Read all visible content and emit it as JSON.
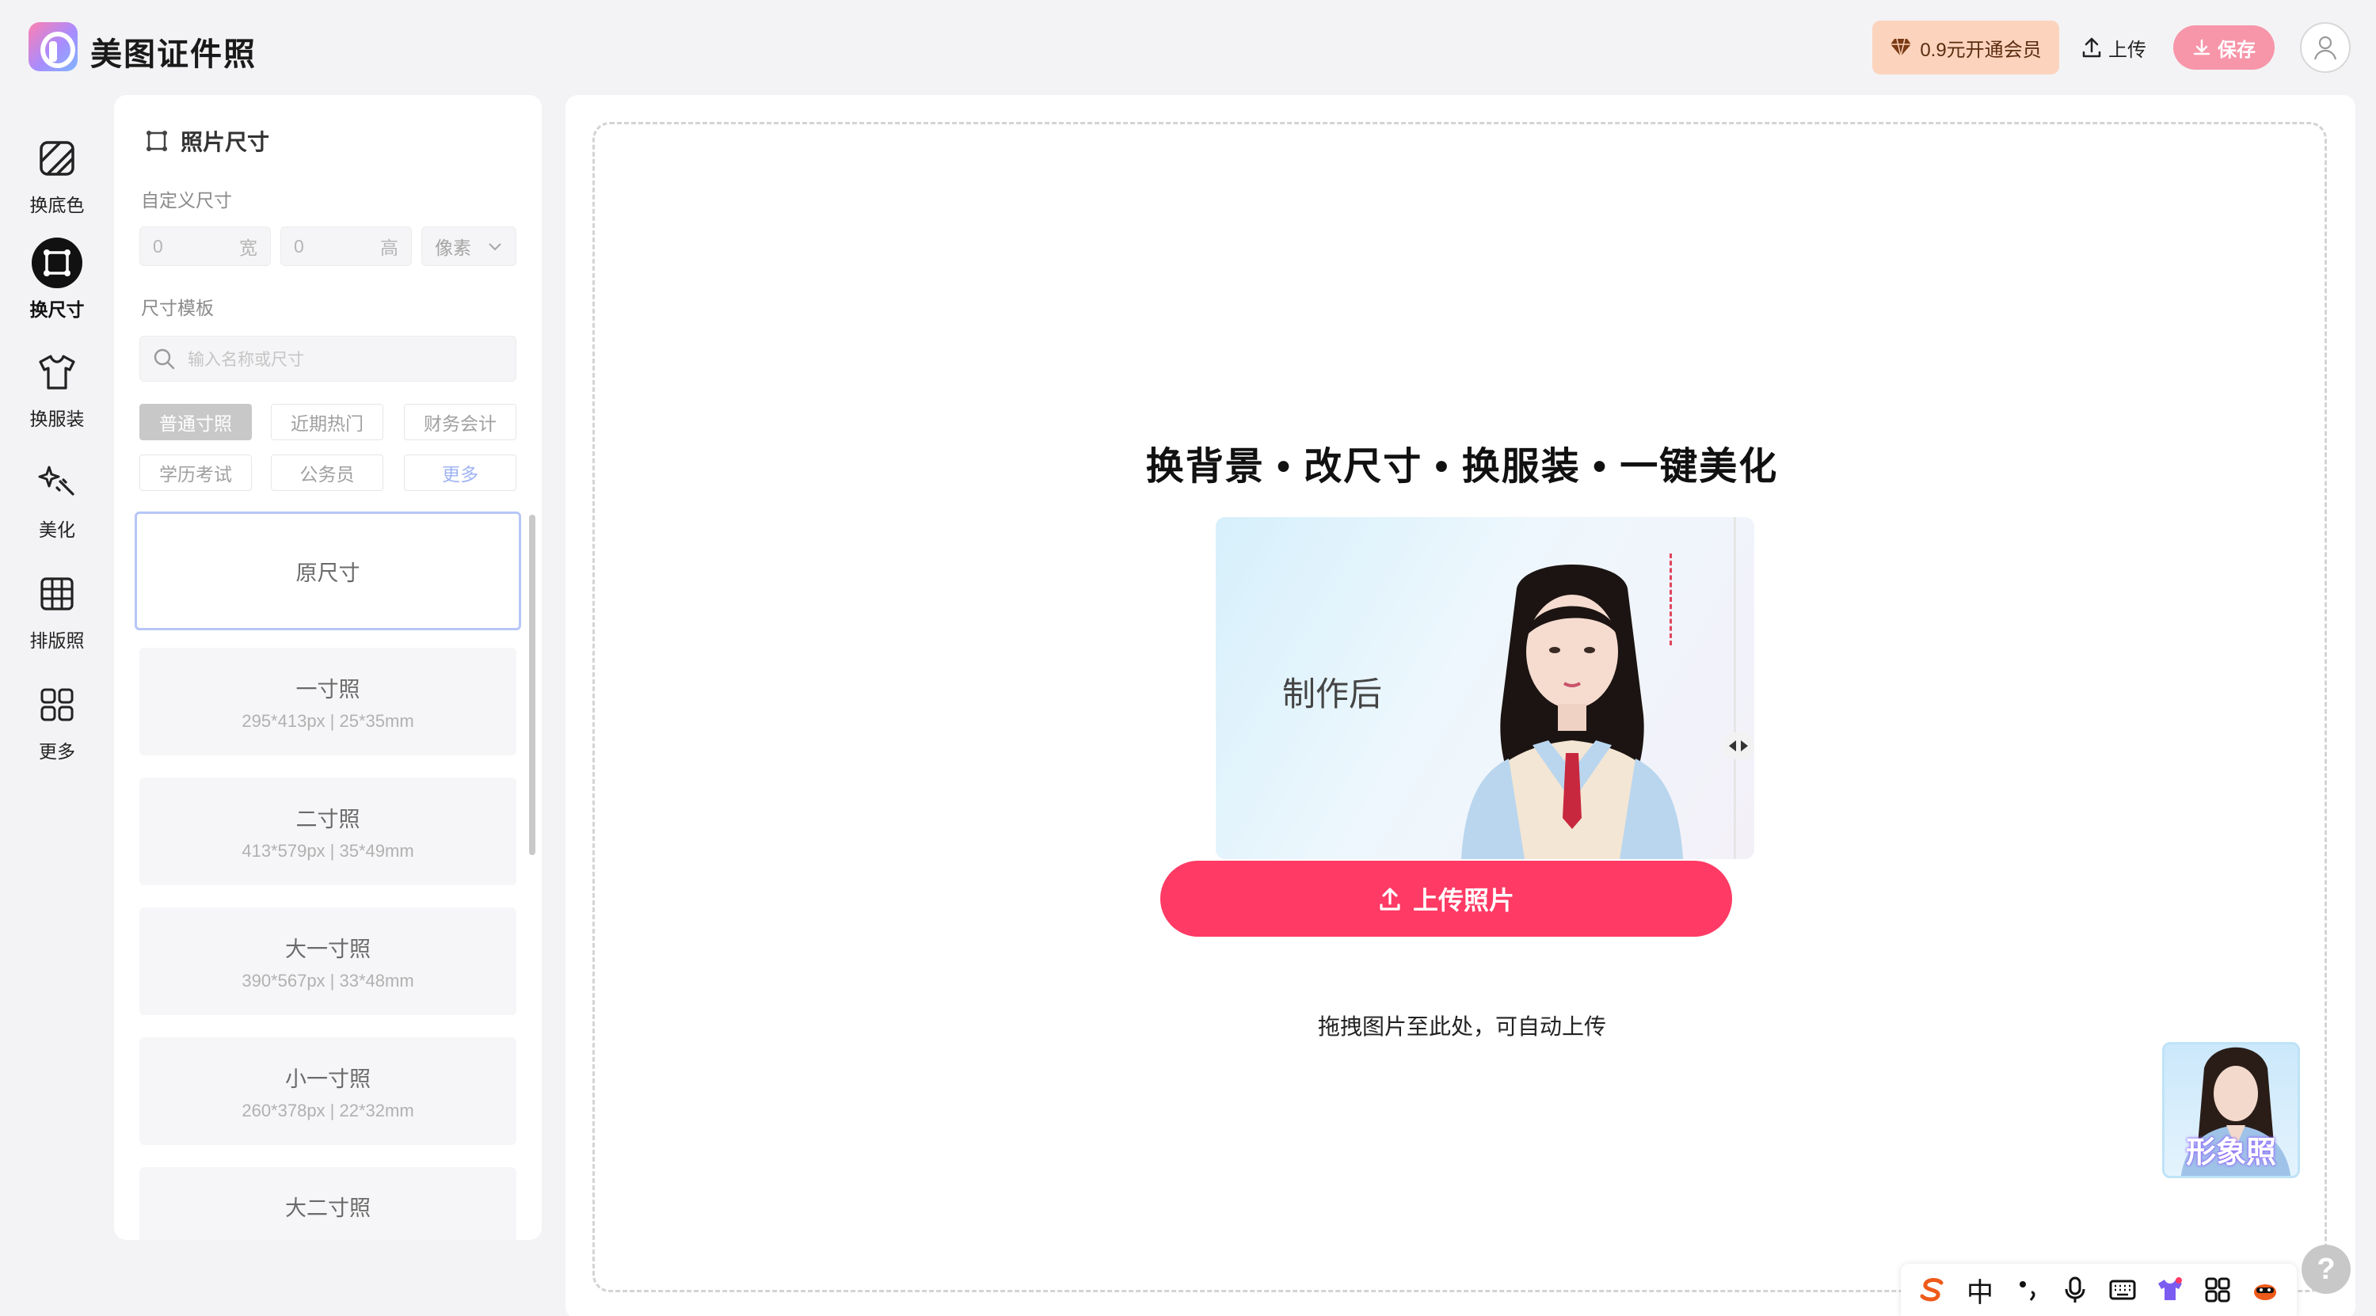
{
  "app": {
    "title": "美图证件照"
  },
  "header": {
    "vip_label": "0.9元开通会员",
    "upload_label": "上传",
    "save_label": "保存"
  },
  "nav": {
    "items": [
      {
        "label": "换底色",
        "icon": "background-color-icon"
      },
      {
        "label": "换尺寸",
        "icon": "resize-icon",
        "active": true
      },
      {
        "label": "换服装",
        "icon": "tshirt-icon"
      },
      {
        "label": "美化",
        "icon": "sparkle-icon"
      },
      {
        "label": "排版照",
        "icon": "grid-layout-icon"
      },
      {
        "label": "更多",
        "icon": "apps-icon"
      }
    ]
  },
  "panel": {
    "title": "照片尺寸",
    "custom_size_label": "自定义尺寸",
    "width": {
      "value": "0",
      "unit_label": "宽"
    },
    "height": {
      "value": "0",
      "unit_label": "高"
    },
    "unit_select": "像素",
    "template_label": "尺寸模板",
    "search_placeholder": "输入名称或尺寸",
    "tags": [
      "普通寸照",
      "近期热门",
      "财务会计",
      "学历考试",
      "公务员",
      "更多"
    ],
    "active_tag": "普通寸照",
    "sizes": [
      {
        "name": "原尺寸",
        "spec": ""
      },
      {
        "name": "一寸照",
        "spec": "295*413px | 25*35mm"
      },
      {
        "name": "二寸照",
        "spec": "413*579px | 35*49mm"
      },
      {
        "name": "大一寸照",
        "spec": "390*567px | 33*48mm"
      },
      {
        "name": "小一寸照",
        "spec": "260*378px | 22*32mm"
      },
      {
        "name": "大二寸照",
        "spec": ""
      }
    ]
  },
  "main": {
    "headline": "换背景 • 改尺寸 • 换服装 • 一键美化",
    "preview_label": "制作后",
    "upload_button": "上传照片",
    "hint": "拖拽图片至此处，可自动上传",
    "promo_label": "形象照"
  },
  "ime": {
    "items": [
      "sogou-icon",
      "中",
      "punctuation-icon",
      "microphone-icon",
      "keyboard-icon",
      "skin-icon",
      "grid-icon",
      "mascot-icon"
    ]
  },
  "help_label": "?",
  "colors": {
    "accent": "#ff3a64",
    "save": "#f795a9",
    "vip_bg": "#fcd4bd",
    "selected_border": "#b6c6f7"
  }
}
